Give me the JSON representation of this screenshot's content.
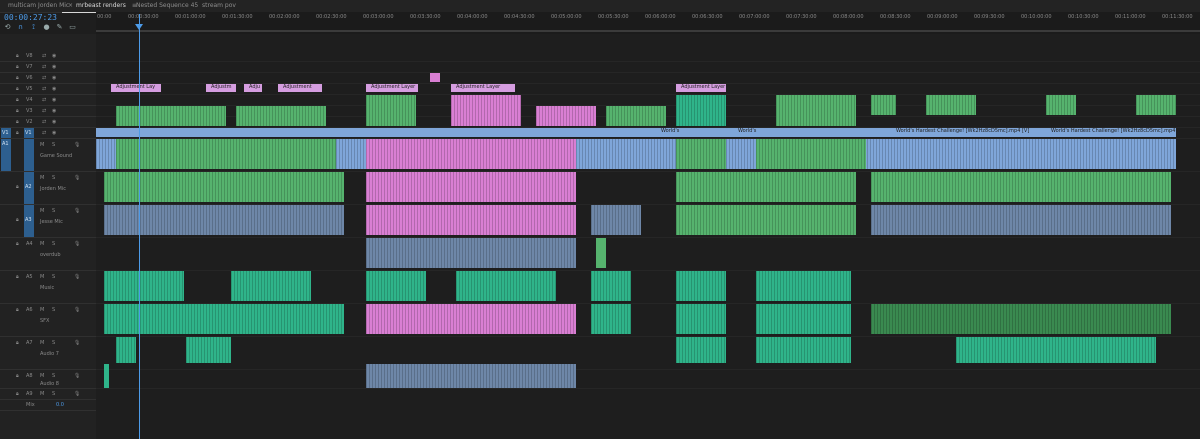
{
  "tabs": [
    {
      "label": "multicam Jorden Mic",
      "active": false
    },
    {
      "label": "mrbeast renders",
      "active": true
    },
    {
      "label": "Nested Sequence 45",
      "active": false
    },
    {
      "label": "stream pov",
      "active": false
    }
  ],
  "timecode": "00:00:27:23",
  "ruler_labels": [
    "00:00",
    "00:00:30:00",
    "00:01:00:00",
    "00:01:30:00",
    "00:02:00:00",
    "00:02:30:00",
    "00:03:00:00",
    "00:03:30:00",
    "00:04:00:00",
    "00:04:30:00",
    "00:05:00:00",
    "00:05:30:00",
    "00:06:00:00",
    "00:06:30:00",
    "00:07:00:00",
    "00:07:30:00",
    "00:08:00:00",
    "00:08:30:00",
    "00:09:00:00",
    "00:09:30:00",
    "00:10:00:00",
    "00:10:30:00",
    "00:11:00:00",
    "00:11:30:00"
  ],
  "video_tracks": [
    {
      "id": "V8"
    },
    {
      "id": "V7"
    },
    {
      "id": "V6"
    },
    {
      "id": "V5"
    },
    {
      "id": "V4"
    },
    {
      "id": "V3"
    },
    {
      "id": "V2"
    },
    {
      "id": "V1",
      "source": "V1"
    }
  ],
  "audio_tracks": [
    {
      "id": "A1",
      "source": "A1",
      "name": "Game Sound"
    },
    {
      "id": "A2",
      "name": "Jorden Mic"
    },
    {
      "id": "A3",
      "name": "Jesse Mic"
    },
    {
      "id": "A4",
      "name": "overdub"
    },
    {
      "id": "A5",
      "name": "Music"
    },
    {
      "id": "A6",
      "name": "SFX"
    },
    {
      "id": "A7",
      "name": "Audio 7"
    },
    {
      "id": "A8",
      "name": "Audio 8"
    },
    {
      "id": "A9",
      "name": ""
    }
  ],
  "mix": {
    "label": "Mix",
    "value": "0.0"
  },
  "clip_labels": {
    "adjustment_layer": "Adjustment Layer",
    "adjustment_short1": "Adjustment Lay",
    "adjustment_short2": "Adjustm",
    "adjustment_short3": "Adju",
    "adjustment_short4": "Adjustment",
    "worlds": "World's",
    "worlds_hardest": "World's Hardest Challenge! [Wk2Hz8cD5mc].mp4 [V]"
  },
  "colors": {
    "accent": "#4d9be8",
    "green": "#56b36e",
    "pink": "#d97fd3",
    "blue": "#7fa6d9",
    "teal": "#2fb48a"
  }
}
